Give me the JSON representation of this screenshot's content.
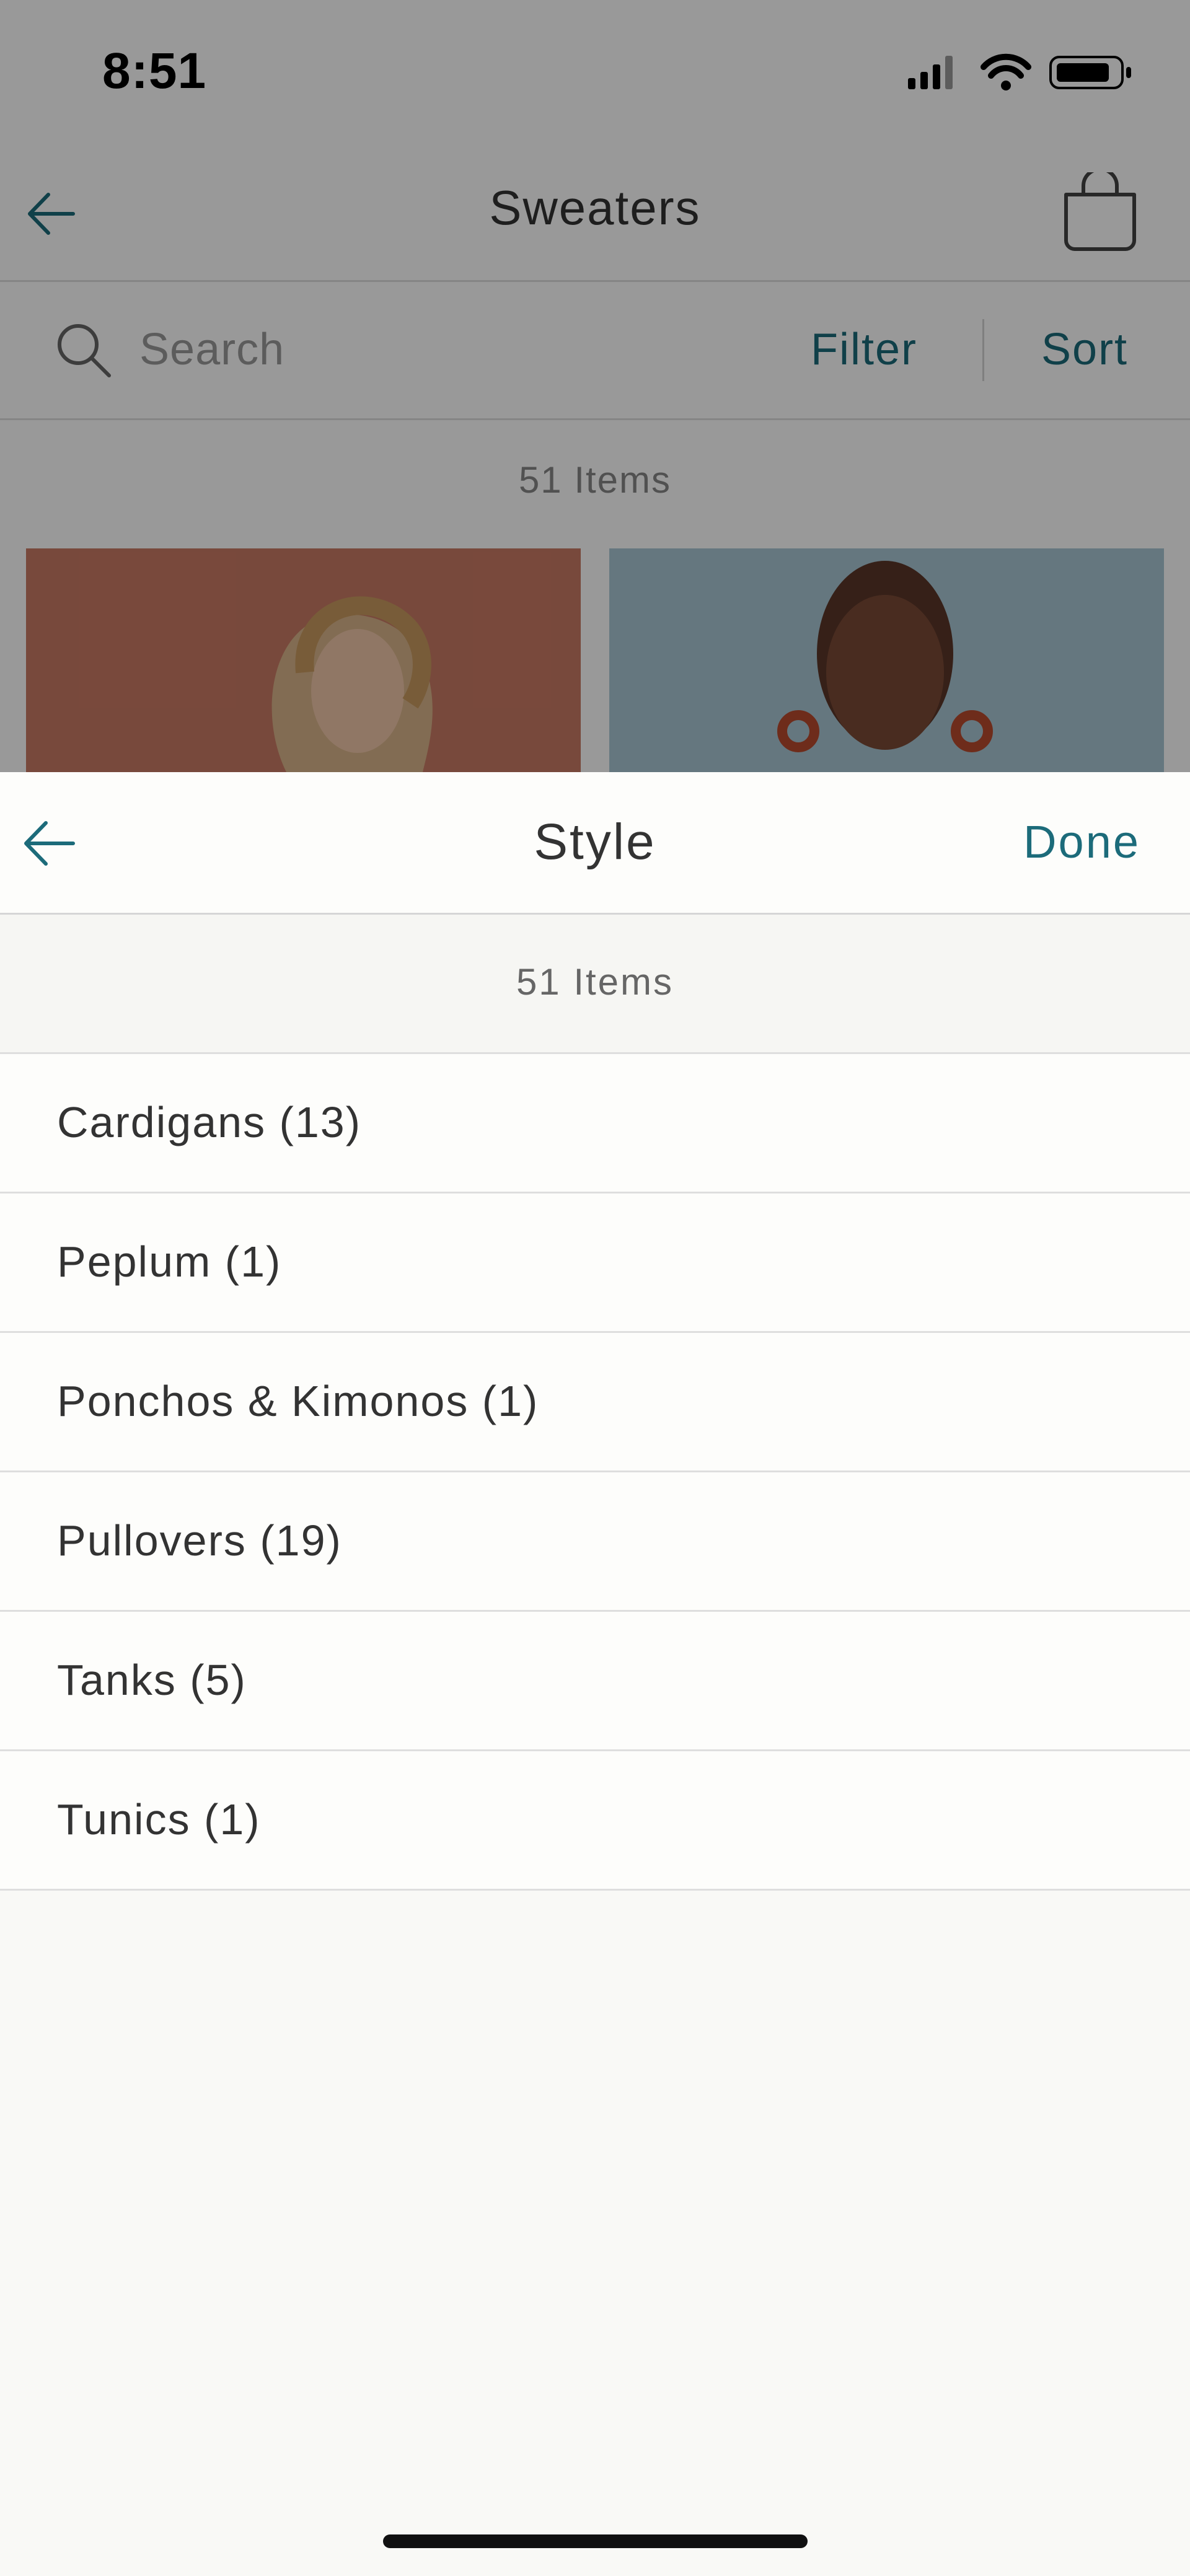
{
  "status_bar": {
    "time": "8:51"
  },
  "background_page": {
    "nav": {
      "title": "Sweaters"
    },
    "search": {
      "placeholder": "Search",
      "filter_label": "Filter",
      "sort_label": "Sort"
    },
    "item_count": "51 Items"
  },
  "sheet": {
    "title": "Style",
    "done_label": "Done",
    "item_count": "51 Items",
    "options": [
      {
        "label": "Cardigans (13)"
      },
      {
        "label": "Peplum (1)"
      },
      {
        "label": "Ponchos & Kimonos (1)"
      },
      {
        "label": "Pullovers (19)"
      },
      {
        "label": "Tanks (5)"
      },
      {
        "label": "Tunics (1)"
      }
    ]
  },
  "colors": {
    "accent": "#1c6b7a",
    "text": "#333333",
    "divider": "#dedede",
    "sheet_bg": "#f9f9f6"
  },
  "icons": [
    "back-arrow-icon",
    "shopping-bag-icon",
    "search-icon",
    "signal-icon",
    "wifi-icon",
    "battery-icon"
  ]
}
